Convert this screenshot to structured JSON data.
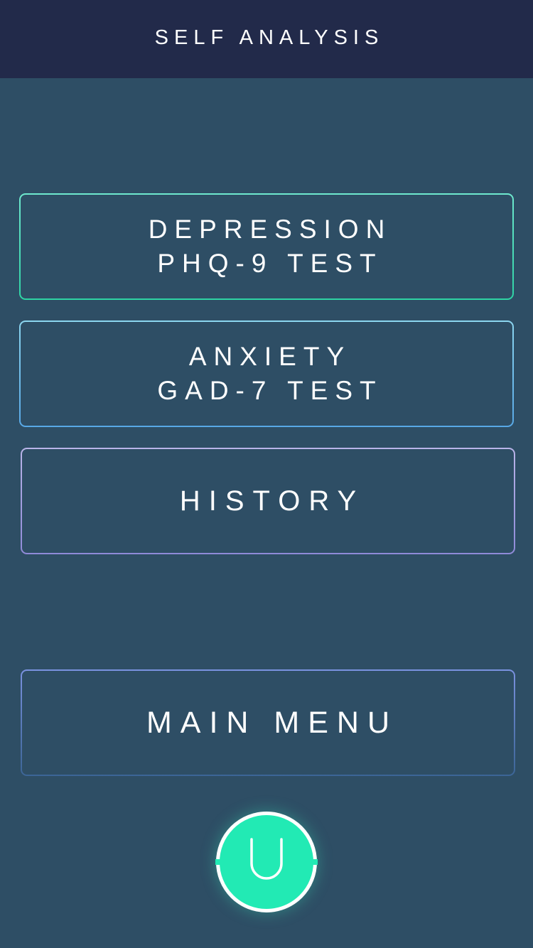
{
  "header": {
    "title": "SELF ANALYSIS"
  },
  "menu": {
    "depression": {
      "line1": "DEPRESSION",
      "line2": "PHQ-9 TEST"
    },
    "anxiety": {
      "line1": "ANXIETY",
      "line2": "GAD-7 TEST"
    },
    "history": {
      "label": "HISTORY"
    },
    "main_menu": {
      "label": "MAIN MENU"
    }
  },
  "home_button": {
    "icon": "u-logo-icon"
  },
  "colors": {
    "header_bg": "#222a4a",
    "page_bg": "#2e4e65",
    "accent_teal": "#22eab4",
    "border_depression": "#2ed3a4",
    "border_anxiety": "#58a8e6",
    "border_history": "#8f8ad8",
    "border_main_menu": "#5a7cc0"
  }
}
